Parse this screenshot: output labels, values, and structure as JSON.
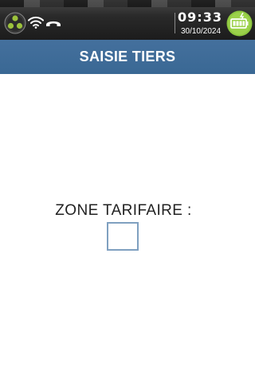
{
  "status_bar": {
    "time": "09:33",
    "date": "30/10/2024",
    "icons": [
      "network-logo-icon",
      "wifi-icon",
      "phone-hangup-icon",
      "battery-charging-icon"
    ],
    "colors": {
      "background": "#1c1c1c",
      "battery_accent": "#8cc63f"
    }
  },
  "header": {
    "title": "SAISIE TIERS",
    "background": "#3d6b98"
  },
  "form": {
    "label": "ZONE TARIFAIRE :",
    "input_value": "",
    "input_border": "#7fa0c0"
  }
}
